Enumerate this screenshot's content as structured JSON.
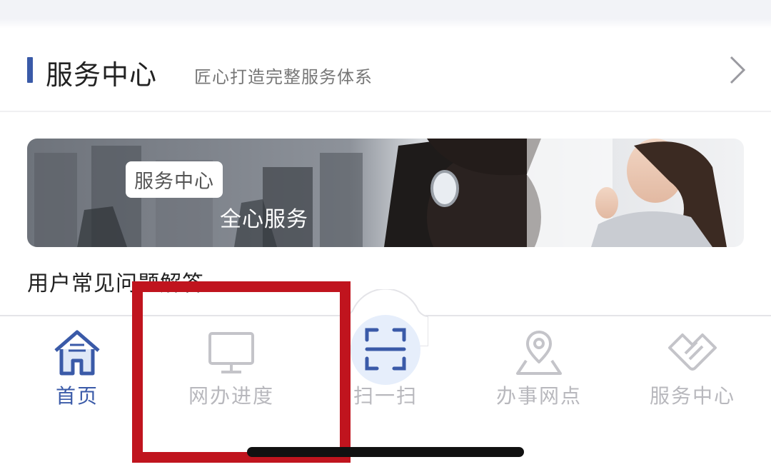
{
  "section": {
    "title": "服务中心",
    "subtitle": "匠心打造完整服务体系"
  },
  "banner": {
    "tag": "服务中心",
    "text": "全心服务"
  },
  "faq": {
    "label": "用户常见问题解答"
  },
  "tabbar": {
    "tabs": [
      {
        "label": "首页",
        "icon": "home-icon",
        "active": true
      },
      {
        "label": "网办进度",
        "icon": "monitor-icon",
        "active": false
      },
      {
        "label": "扫一扫",
        "icon": "scan-icon",
        "active": false
      },
      {
        "label": "办事网点",
        "icon": "map-pin-icon",
        "active": false
      },
      {
        "label": "服务中心",
        "icon": "service-handshake-icon",
        "active": false
      }
    ]
  },
  "colors": {
    "accent": "#3a5aa8",
    "inactive": "#b8b8bd",
    "highlight": "#c0141e",
    "scan_bg": "#e6eefb"
  }
}
